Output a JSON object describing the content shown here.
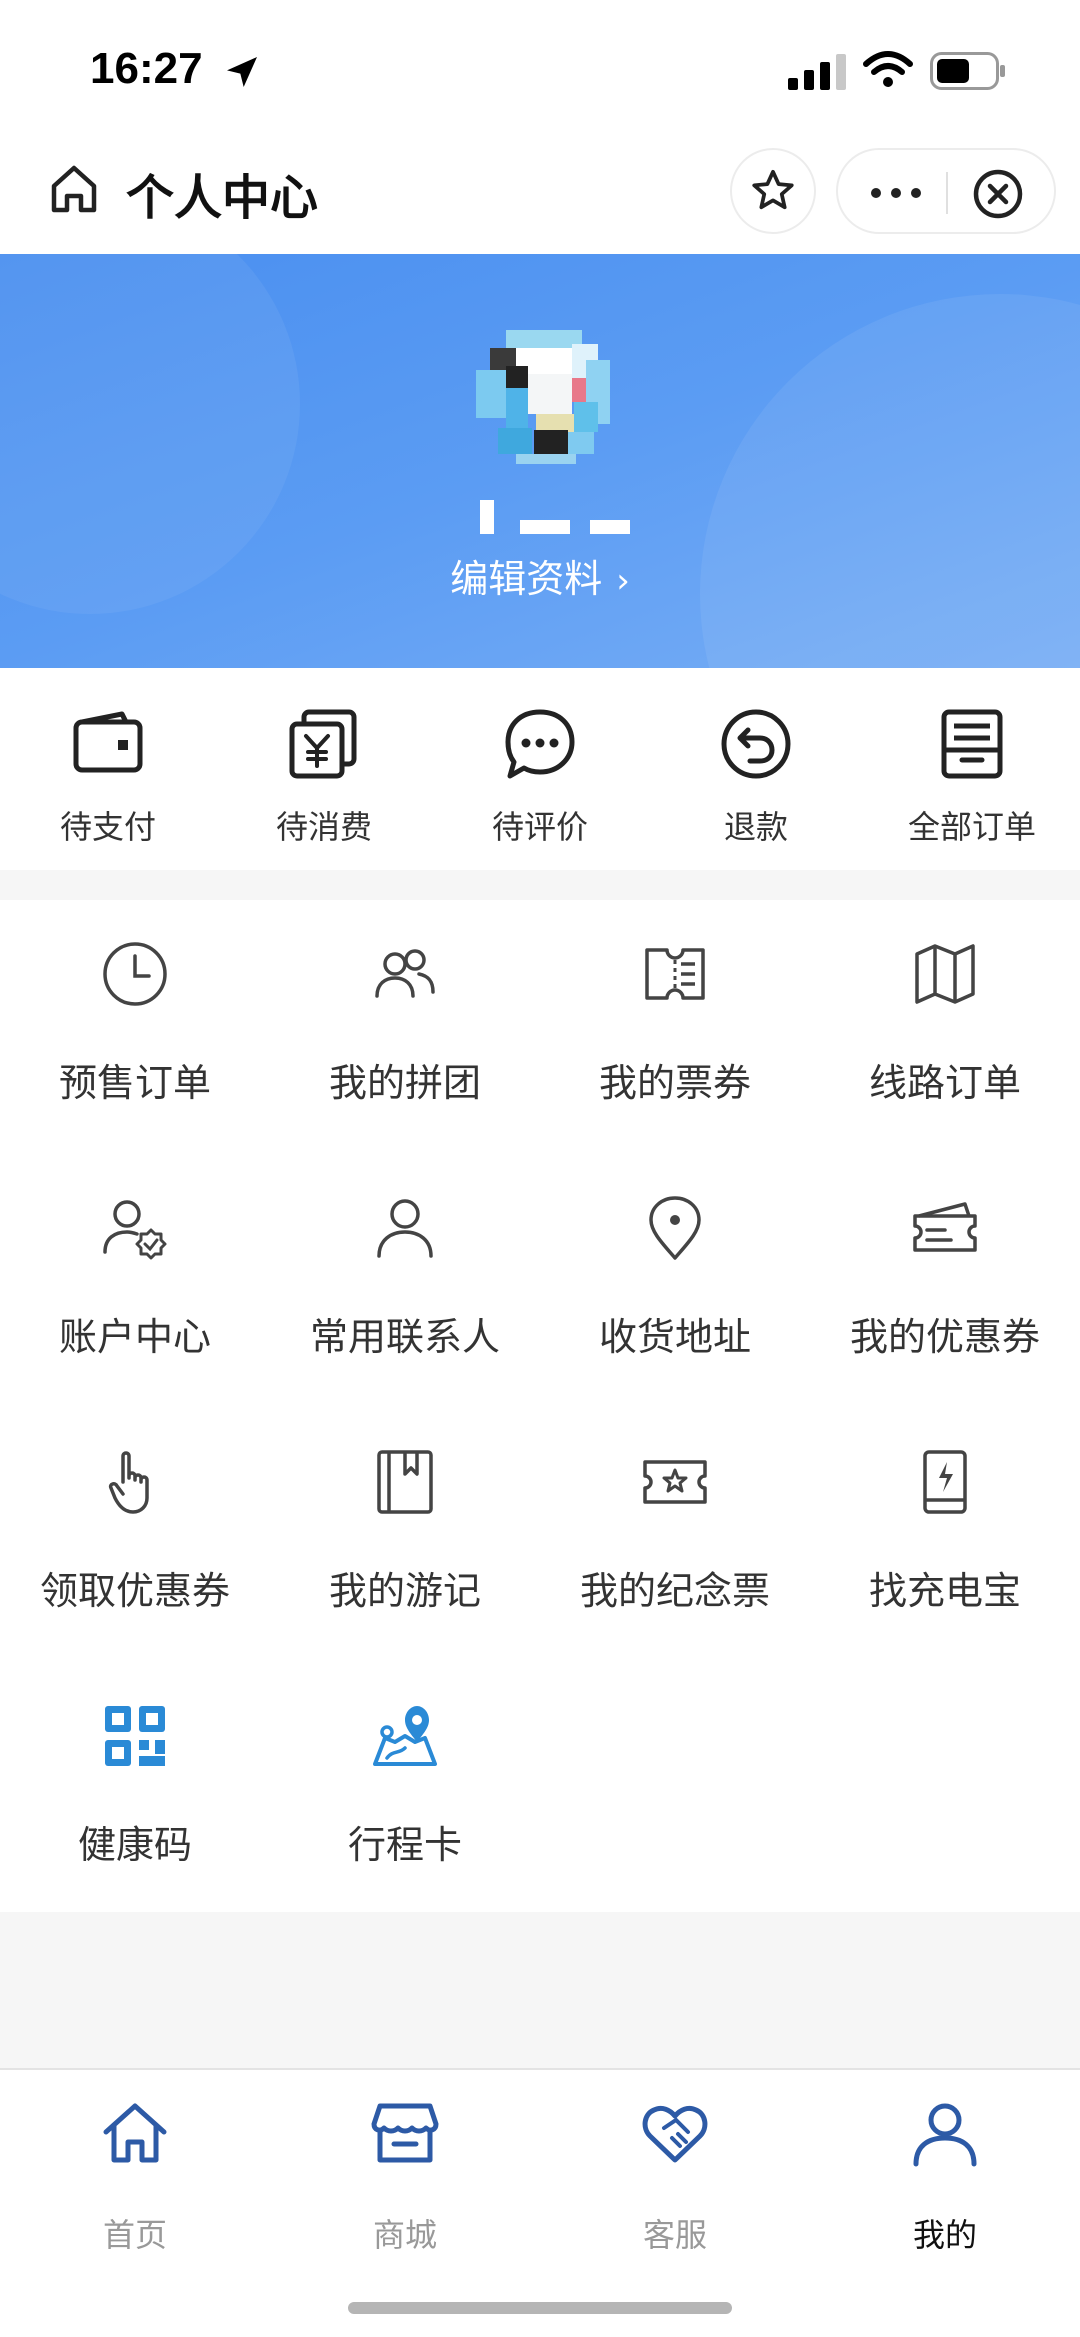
{
  "status_bar": {
    "time": "16:27"
  },
  "header": {
    "title": "个人中心"
  },
  "profile": {
    "edit_label": "编辑资料"
  },
  "orders": [
    {
      "label": "待支付",
      "icon": "wallet-icon"
    },
    {
      "label": "待消费",
      "icon": "yen-receipt-icon"
    },
    {
      "label": "待评价",
      "icon": "chat-bubble-icon"
    },
    {
      "label": "退款",
      "icon": "refund-icon"
    },
    {
      "label": "全部订单",
      "icon": "archive-icon"
    }
  ],
  "services": [
    {
      "label": "预售订单",
      "icon": "clock-icon"
    },
    {
      "label": "我的拼团",
      "icon": "group-icon"
    },
    {
      "label": "我的票券",
      "icon": "ticket-icon"
    },
    {
      "label": "线路订单",
      "icon": "map-icon"
    },
    {
      "label": "账户中心",
      "icon": "account-verified-icon"
    },
    {
      "label": "常用联系人",
      "icon": "person-icon"
    },
    {
      "label": "收货地址",
      "icon": "location-pin-icon"
    },
    {
      "label": "我的优惠券",
      "icon": "coupon-icon"
    },
    {
      "label": "领取优惠券",
      "icon": "hand-pointer-icon"
    },
    {
      "label": "我的游记",
      "icon": "notebook-icon"
    },
    {
      "label": "我的纪念票",
      "icon": "star-ticket-icon"
    },
    {
      "label": "找充电宝",
      "icon": "power-bank-icon"
    },
    {
      "label": "健康码",
      "icon": "qr-code-icon"
    },
    {
      "label": "行程卡",
      "icon": "map-route-icon"
    }
  ],
  "tabs": [
    {
      "label": "首页",
      "icon": "home-icon",
      "active": false
    },
    {
      "label": "商城",
      "icon": "store-icon",
      "active": false
    },
    {
      "label": "客服",
      "icon": "handshake-heart-icon",
      "active": false
    },
    {
      "label": "我的",
      "icon": "user-icon",
      "active": true
    }
  ],
  "colors": {
    "banner": "#5b9cf3",
    "accent": "#2a7fd4",
    "tab_icon": "#2d5aa6"
  }
}
